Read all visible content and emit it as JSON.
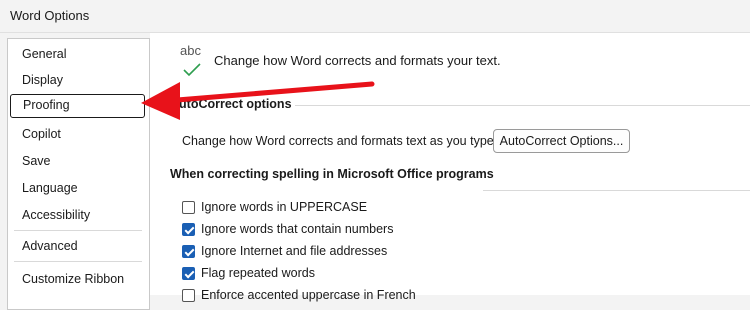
{
  "window": {
    "title": "Word Options"
  },
  "sidebar": {
    "items": [
      {
        "label": "General"
      },
      {
        "label": "Display"
      },
      {
        "label": "Proofing",
        "selected": true
      },
      {
        "label": "Copilot"
      },
      {
        "label": "Save"
      },
      {
        "label": "Language"
      },
      {
        "label": "Accessibility"
      },
      {
        "label": "Advanced"
      },
      {
        "label": "Customize Ribbon"
      }
    ]
  },
  "header": {
    "icon_text": "abc",
    "text": "Change how Word corrects and formats your text."
  },
  "autocorrect": {
    "title": "AutoCorrect options",
    "description": "Change how Word corrects and formats text as you type:",
    "button_label": "AutoCorrect Options..."
  },
  "spelling": {
    "title": "When correcting spelling in Microsoft Office programs",
    "options": [
      {
        "label": "Ignore words in UPPERCASE",
        "checked": false
      },
      {
        "label": "Ignore words that contain numbers",
        "checked": true
      },
      {
        "label": "Ignore Internet and file addresses",
        "checked": true
      },
      {
        "label": "Flag repeated words",
        "checked": true
      },
      {
        "label": "Enforce accented uppercase in French",
        "checked": false
      }
    ]
  },
  "annotation": {
    "arrow_color": "#e8121a"
  }
}
